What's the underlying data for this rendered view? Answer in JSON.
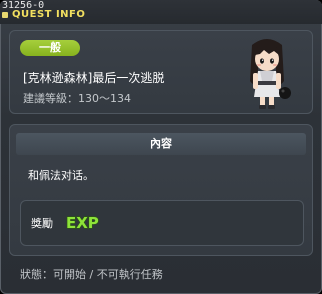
{
  "window": {
    "quest_id": "31256-0",
    "title": "QUEST INFO"
  },
  "quest": {
    "category_badge": "一般",
    "name": "[克林逊森林]最后一次逃脱",
    "level_range": "建議等級：130～134",
    "npc_portrait_icon": "npc-girl-portrait-icon"
  },
  "content": {
    "header": "內容",
    "description": "和佩法对话。"
  },
  "reward": {
    "label": "獎勵",
    "exp_label": "EXP",
    "exp_icon": "exp-icon"
  },
  "status": {
    "text": "狀態：可開始 / 不可執行任務"
  },
  "colors": {
    "title_text": "#f2e060",
    "badge_green": "#97c02c",
    "exp_green": "#8ee33a",
    "exp_yellow": "#f0e040"
  }
}
